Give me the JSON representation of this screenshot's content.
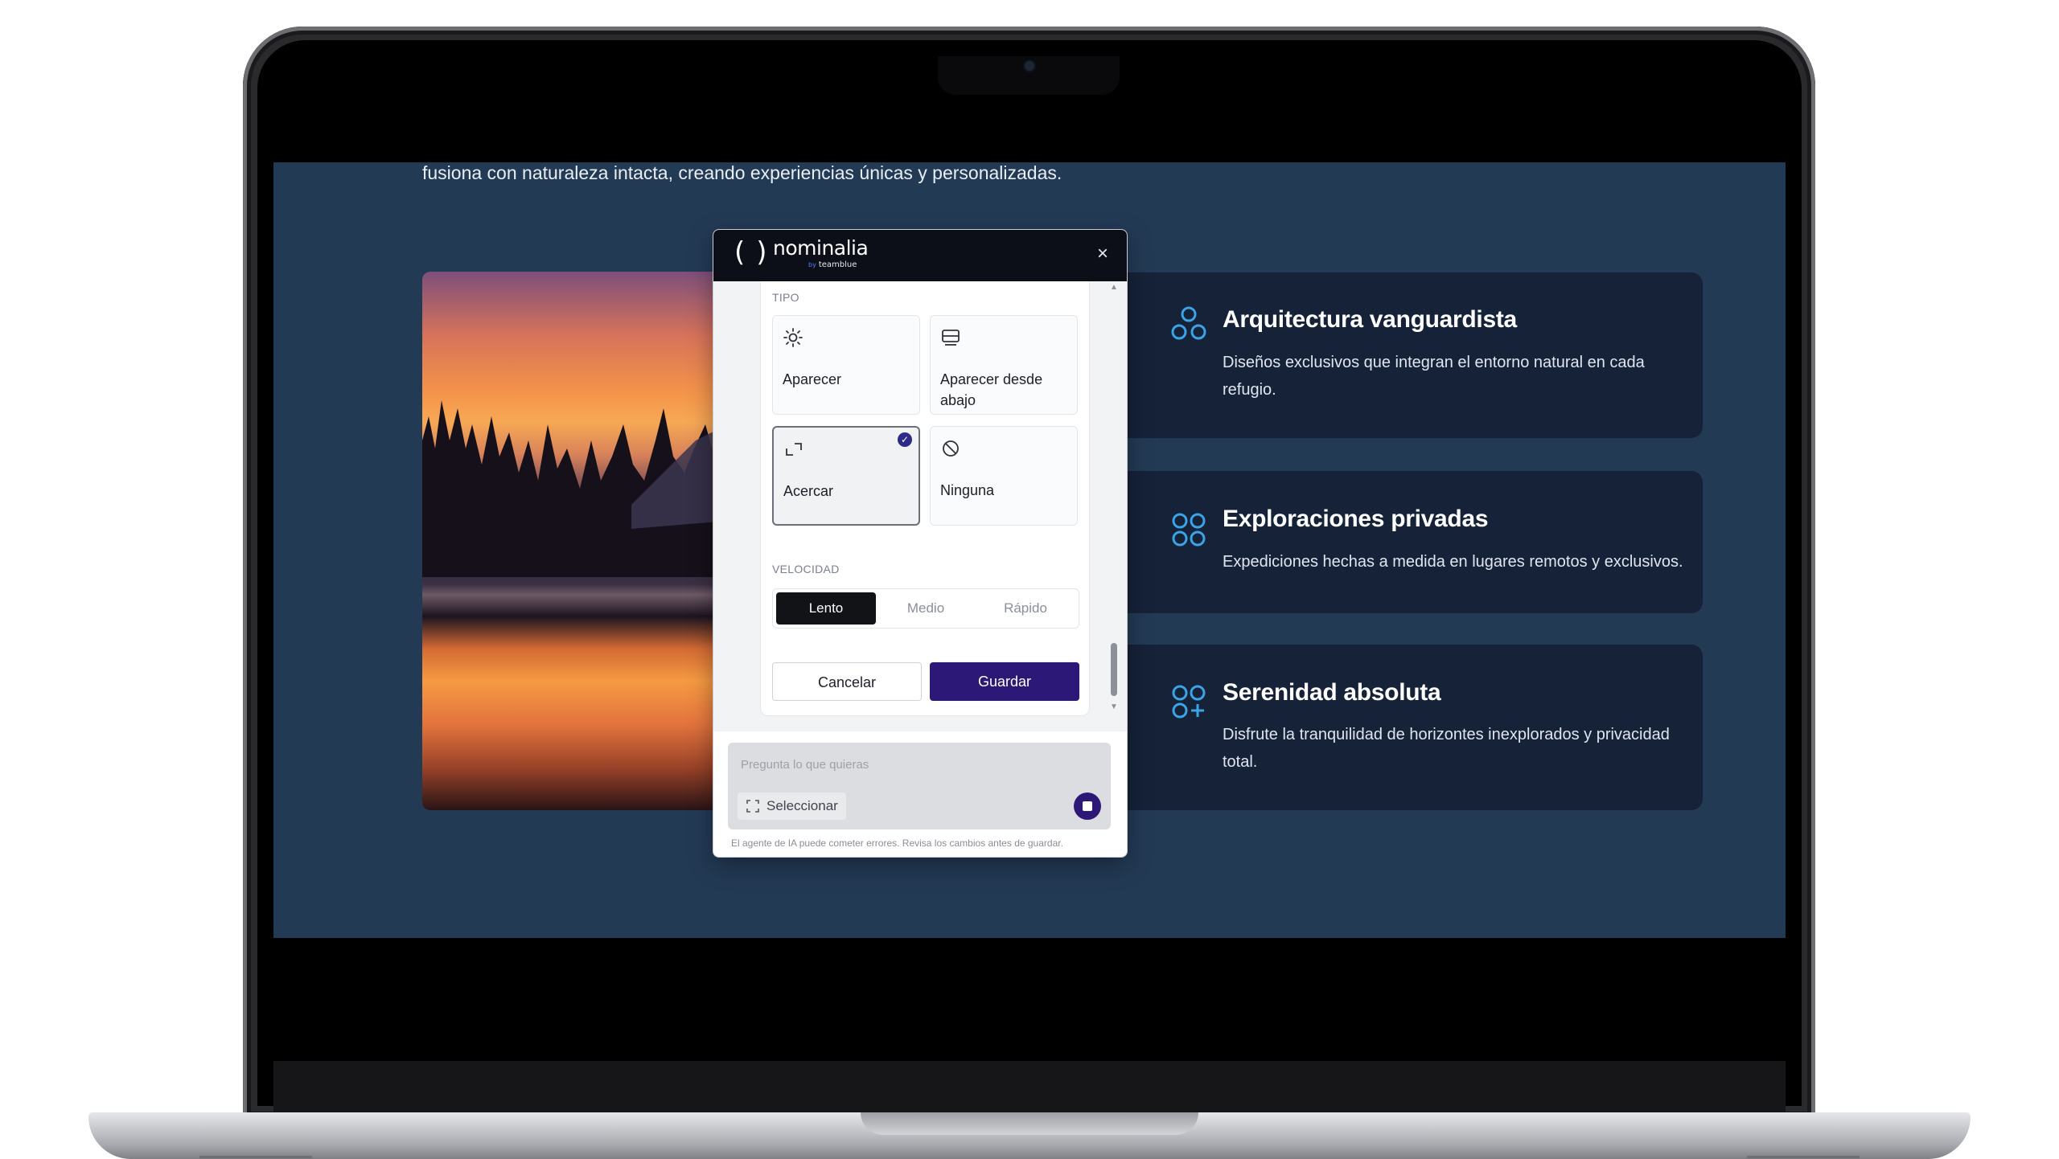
{
  "page": {
    "intro_text": "fusiona con naturaleza intacta, creando experiencias únicas y personalizadas."
  },
  "features": [
    {
      "title": "Arquitectura vanguardista",
      "description": "Diseños exclusivos que integran el entorno natural en cada refugio.",
      "icon": "circles-triangle-icon"
    },
    {
      "title": "Exploraciones privadas",
      "description": "Expediciones hechas a medida en lugares remotos y exclusivos.",
      "icon": "four-circles-icon"
    },
    {
      "title": "Serenidad absoluta",
      "description": "Disfrute la tranquilidad de horizontes inexplorados y privacidad total.",
      "icon": "circles-plus-icon"
    }
  ],
  "colors": {
    "screen_bg": "#233a55",
    "card_bg": "#152238",
    "accent_icon": "#3ba3e6",
    "save_button": "#2c1876",
    "panel_header": "#0c0f17"
  },
  "editor": {
    "brand": {
      "name": "nominalia",
      "by": "by",
      "sub": "teamblue",
      "brackets": "()"
    },
    "close_label": "×",
    "tipo": {
      "label": "TIPO",
      "options": [
        {
          "label": "Aparecer",
          "icon": "sun-icon",
          "selected": false
        },
        {
          "label": "Aparecer desde abajo",
          "icon": "slide-up-icon",
          "selected": false
        },
        {
          "label": "Acercar",
          "icon": "expand-icon",
          "selected": true
        },
        {
          "label": "Ninguna",
          "icon": "ban-icon",
          "selected": false
        }
      ],
      "check_mark": "✓"
    },
    "velocidad": {
      "label": "VELOCIDAD",
      "options": [
        "Lento",
        "Medio",
        "Rápido"
      ],
      "selected": "Lento"
    },
    "buttons": {
      "cancel": "Cancelar",
      "save": "Guardar"
    },
    "chat": {
      "placeholder": "Pregunta lo que quieras",
      "select_label": "Seleccionar"
    },
    "disclaimer": "El agente de IA puede cometer errores. Revisa los cambios antes de guardar."
  }
}
